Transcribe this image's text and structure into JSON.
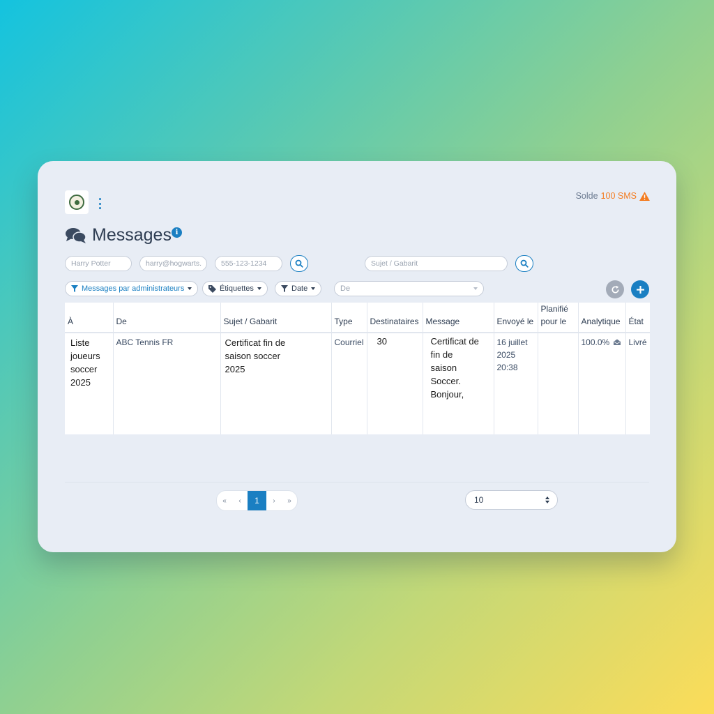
{
  "header": {
    "balance_label": "Solde",
    "balance_amount": "100 SMS",
    "title": "Messages"
  },
  "search": {
    "name_placeholder": "Harry Potter",
    "email_placeholder": "harry@hogwarts.",
    "phone_placeholder": "555-123-1234",
    "subject_placeholder": "Sujet / Gabarit"
  },
  "filters": {
    "admins": "Messages par administrateurs",
    "labels": "Étiquettes",
    "date": "Date",
    "from_placeholder": "De"
  },
  "colors": {
    "accent": "#1a7fc2",
    "warning": "#f47c20",
    "refresh": "#a3abb8"
  },
  "table": {
    "headers": [
      "À",
      "De",
      "Sujet / Gabarit",
      "Type",
      "Destinataires",
      "Message",
      "Envoyé le",
      "Planifié pour le",
      "Analytique",
      "État"
    ],
    "rows": [
      {
        "to": "Liste joueurs soccer 2025",
        "from": "ABC Tennis FR",
        "subject": "Certificat fin de saison soccer 2025",
        "type": "Courriel",
        "recipients": "30",
        "message": "Certificat de fin de saison Soccer. Bonjour,",
        "sent": "16 juillet 2025 20:38",
        "scheduled": "",
        "analytics": "100.0%",
        "status": "Livré"
      }
    ]
  },
  "pagination": {
    "first": "«",
    "prev": "‹",
    "current": "1",
    "next": "›",
    "last": "»",
    "per_page": "10"
  }
}
